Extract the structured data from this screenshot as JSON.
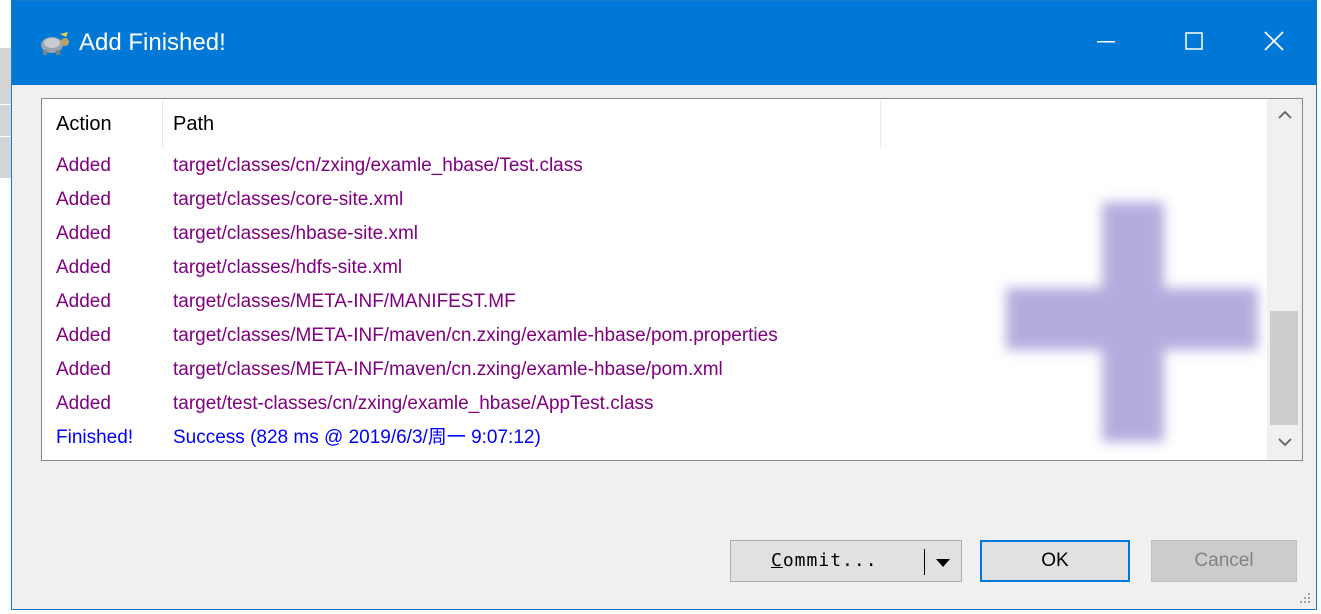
{
  "window": {
    "title": "Add Finished!",
    "controls": {
      "minimize": "minimize",
      "maximize": "maximize",
      "close": "close"
    },
    "icon": "tortoise-icon"
  },
  "list": {
    "columns": [
      "Action",
      "Path"
    ],
    "rows": [
      {
        "action": "Added",
        "path": "target/classes/cn/zxing/examle_hbase/Test.class",
        "status": "added"
      },
      {
        "action": "Added",
        "path": "target/classes/core-site.xml",
        "status": "added"
      },
      {
        "action": "Added",
        "path": "target/classes/hbase-site.xml",
        "status": "added"
      },
      {
        "action": "Added",
        "path": "target/classes/hdfs-site.xml",
        "status": "added"
      },
      {
        "action": "Added",
        "path": "target/classes/META-INF/MANIFEST.MF",
        "status": "added"
      },
      {
        "action": "Added",
        "path": "target/classes/META-INF/maven/cn.zxing/examle-hbase/pom.properties",
        "status": "added"
      },
      {
        "action": "Added",
        "path": "target/classes/META-INF/maven/cn.zxing/examle-hbase/pom.xml",
        "status": "added"
      },
      {
        "action": "Added",
        "path": "target/test-classes/cn/zxing/examle_hbase/AppTest.class",
        "status": "added"
      },
      {
        "action": "Finished!",
        "path": "Success (828 ms @ 2019/6/3/周一 9:07:12)",
        "status": "finished"
      }
    ],
    "watermark_icon": "plus-icon"
  },
  "buttons": {
    "commit_label_rest": "ommit...",
    "commit_label_accel": "C",
    "ok_label": "OK",
    "cancel_label": "Cancel"
  },
  "colors": {
    "titlebar": "#0078d7",
    "added_text": "#800080",
    "finished_text": "#0000ff",
    "ok_border": "#0078d7"
  }
}
